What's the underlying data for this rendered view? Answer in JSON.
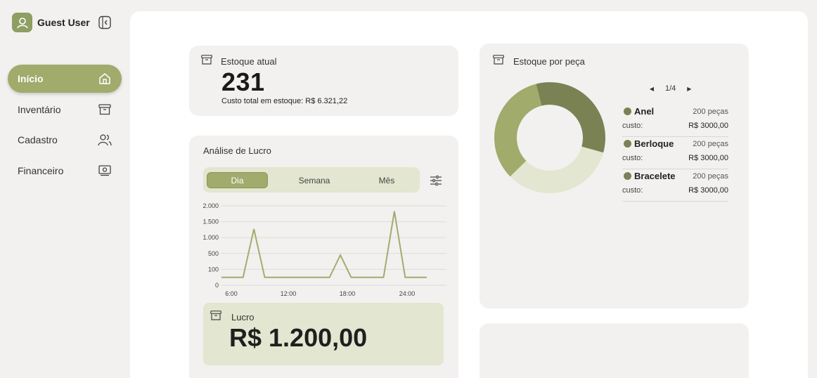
{
  "user": {
    "name": "Guest User",
    "avatar_icon": "user-icon"
  },
  "sidebar": {
    "collapse_icon": "sidebar-collapse-icon",
    "items": [
      {
        "label": "Início",
        "icon": "home-icon",
        "active": true
      },
      {
        "label": "Inventário",
        "icon": "archive-box-icon",
        "active": false
      },
      {
        "label": "Cadastro",
        "icon": "users-icon",
        "active": false
      },
      {
        "label": "Financeiro",
        "icon": "money-icon",
        "active": false
      }
    ]
  },
  "stock_card": {
    "title": "Estoque atual",
    "value": "231",
    "cost_label": "Custo total em estoque:",
    "cost_value": "R$ 6.321,22"
  },
  "profit_card": {
    "title": "Análise de Lucro",
    "tabs": [
      "Dia",
      "Semana",
      "Mês"
    ],
    "active_tab": "Dia",
    "lucro_label": "Lucro",
    "lucro_value": "R$ 1.200,00"
  },
  "chart_data": {
    "type": "line",
    "x": [
      "6:00",
      "7:00",
      "8:00",
      "9:00",
      "10:00",
      "11:00",
      "12:00",
      "13:00",
      "14:00",
      "15:00",
      "16:00",
      "17:00",
      "18:00",
      "19:00",
      "20:00",
      "21:00",
      "22:00",
      "23:00",
      "24:00",
      "25:00"
    ],
    "y": [
      50,
      50,
      50,
      1270,
      50,
      50,
      50,
      50,
      50,
      50,
      50,
      460,
      50,
      50,
      50,
      50,
      1830,
      50,
      50,
      50
    ],
    "y_tick_labels": [
      "0",
      "100",
      "500",
      "1.000",
      "1.500",
      "2.000"
    ],
    "x_tick_labels": [
      "6:00",
      "12:00",
      "18:00",
      "24:00"
    ],
    "color": "#a3ac6f",
    "grid": true
  },
  "pieces_card": {
    "title": "Estoque por peça",
    "pager": {
      "page": "1/4"
    },
    "items": [
      {
        "name": "Anel",
        "qty": "200 peças",
        "cost_label": "custo:",
        "cost": "R$ 3000,00"
      },
      {
        "name": "Berloque",
        "qty": "200 peças",
        "cost_label": "custo:",
        "cost": "R$ 3000,00"
      },
      {
        "name": "Bracelete",
        "qty": "200 peças",
        "cost_label": "custo:",
        "cost": "R$ 3000,00"
      }
    ],
    "donut": {
      "slices": [
        {
          "name": "Anel",
          "value": 1,
          "color": "#7a8254"
        },
        {
          "name": "Berloque",
          "value": 1,
          "color": "#e3e6d0"
        },
        {
          "name": "Bracelete",
          "value": 1,
          "color": "#a0ab6c"
        }
      ]
    }
  },
  "colors": {
    "accent": "#a0ab6c",
    "accent_dark": "#7a8254",
    "accent_light": "#e3e6d0",
    "card_bg": "#f2f1ef"
  }
}
